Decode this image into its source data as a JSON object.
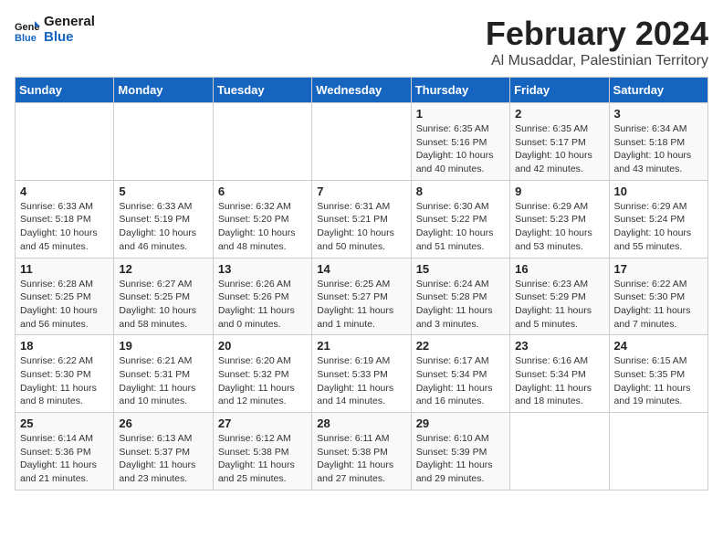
{
  "logo": {
    "line1": "General",
    "line2": "Blue"
  },
  "header": {
    "month_year": "February 2024",
    "location": "Al Musaddar, Palestinian Territory"
  },
  "days_of_week": [
    "Sunday",
    "Monday",
    "Tuesday",
    "Wednesday",
    "Thursday",
    "Friday",
    "Saturday"
  ],
  "weeks": [
    [
      {
        "day": "",
        "info": ""
      },
      {
        "day": "",
        "info": ""
      },
      {
        "day": "",
        "info": ""
      },
      {
        "day": "",
        "info": ""
      },
      {
        "day": "1",
        "info": "Sunrise: 6:35 AM\nSunset: 5:16 PM\nDaylight: 10 hours\nand 40 minutes."
      },
      {
        "day": "2",
        "info": "Sunrise: 6:35 AM\nSunset: 5:17 PM\nDaylight: 10 hours\nand 42 minutes."
      },
      {
        "day": "3",
        "info": "Sunrise: 6:34 AM\nSunset: 5:18 PM\nDaylight: 10 hours\nand 43 minutes."
      }
    ],
    [
      {
        "day": "4",
        "info": "Sunrise: 6:33 AM\nSunset: 5:18 PM\nDaylight: 10 hours\nand 45 minutes."
      },
      {
        "day": "5",
        "info": "Sunrise: 6:33 AM\nSunset: 5:19 PM\nDaylight: 10 hours\nand 46 minutes."
      },
      {
        "day": "6",
        "info": "Sunrise: 6:32 AM\nSunset: 5:20 PM\nDaylight: 10 hours\nand 48 minutes."
      },
      {
        "day": "7",
        "info": "Sunrise: 6:31 AM\nSunset: 5:21 PM\nDaylight: 10 hours\nand 50 minutes."
      },
      {
        "day": "8",
        "info": "Sunrise: 6:30 AM\nSunset: 5:22 PM\nDaylight: 10 hours\nand 51 minutes."
      },
      {
        "day": "9",
        "info": "Sunrise: 6:29 AM\nSunset: 5:23 PM\nDaylight: 10 hours\nand 53 minutes."
      },
      {
        "day": "10",
        "info": "Sunrise: 6:29 AM\nSunset: 5:24 PM\nDaylight: 10 hours\nand 55 minutes."
      }
    ],
    [
      {
        "day": "11",
        "info": "Sunrise: 6:28 AM\nSunset: 5:25 PM\nDaylight: 10 hours\nand 56 minutes."
      },
      {
        "day": "12",
        "info": "Sunrise: 6:27 AM\nSunset: 5:25 PM\nDaylight: 10 hours\nand 58 minutes."
      },
      {
        "day": "13",
        "info": "Sunrise: 6:26 AM\nSunset: 5:26 PM\nDaylight: 11 hours\nand 0 minutes."
      },
      {
        "day": "14",
        "info": "Sunrise: 6:25 AM\nSunset: 5:27 PM\nDaylight: 11 hours\nand 1 minute."
      },
      {
        "day": "15",
        "info": "Sunrise: 6:24 AM\nSunset: 5:28 PM\nDaylight: 11 hours\nand 3 minutes."
      },
      {
        "day": "16",
        "info": "Sunrise: 6:23 AM\nSunset: 5:29 PM\nDaylight: 11 hours\nand 5 minutes."
      },
      {
        "day": "17",
        "info": "Sunrise: 6:22 AM\nSunset: 5:30 PM\nDaylight: 11 hours\nand 7 minutes."
      }
    ],
    [
      {
        "day": "18",
        "info": "Sunrise: 6:22 AM\nSunset: 5:30 PM\nDaylight: 11 hours\nand 8 minutes."
      },
      {
        "day": "19",
        "info": "Sunrise: 6:21 AM\nSunset: 5:31 PM\nDaylight: 11 hours\nand 10 minutes."
      },
      {
        "day": "20",
        "info": "Sunrise: 6:20 AM\nSunset: 5:32 PM\nDaylight: 11 hours\nand 12 minutes."
      },
      {
        "day": "21",
        "info": "Sunrise: 6:19 AM\nSunset: 5:33 PM\nDaylight: 11 hours\nand 14 minutes."
      },
      {
        "day": "22",
        "info": "Sunrise: 6:17 AM\nSunset: 5:34 PM\nDaylight: 11 hours\nand 16 minutes."
      },
      {
        "day": "23",
        "info": "Sunrise: 6:16 AM\nSunset: 5:34 PM\nDaylight: 11 hours\nand 18 minutes."
      },
      {
        "day": "24",
        "info": "Sunrise: 6:15 AM\nSunset: 5:35 PM\nDaylight: 11 hours\nand 19 minutes."
      }
    ],
    [
      {
        "day": "25",
        "info": "Sunrise: 6:14 AM\nSunset: 5:36 PM\nDaylight: 11 hours\nand 21 minutes."
      },
      {
        "day": "26",
        "info": "Sunrise: 6:13 AM\nSunset: 5:37 PM\nDaylight: 11 hours\nand 23 minutes."
      },
      {
        "day": "27",
        "info": "Sunrise: 6:12 AM\nSunset: 5:38 PM\nDaylight: 11 hours\nand 25 minutes."
      },
      {
        "day": "28",
        "info": "Sunrise: 6:11 AM\nSunset: 5:38 PM\nDaylight: 11 hours\nand 27 minutes."
      },
      {
        "day": "29",
        "info": "Sunrise: 6:10 AM\nSunset: 5:39 PM\nDaylight: 11 hours\nand 29 minutes."
      },
      {
        "day": "",
        "info": ""
      },
      {
        "day": "",
        "info": ""
      }
    ]
  ]
}
